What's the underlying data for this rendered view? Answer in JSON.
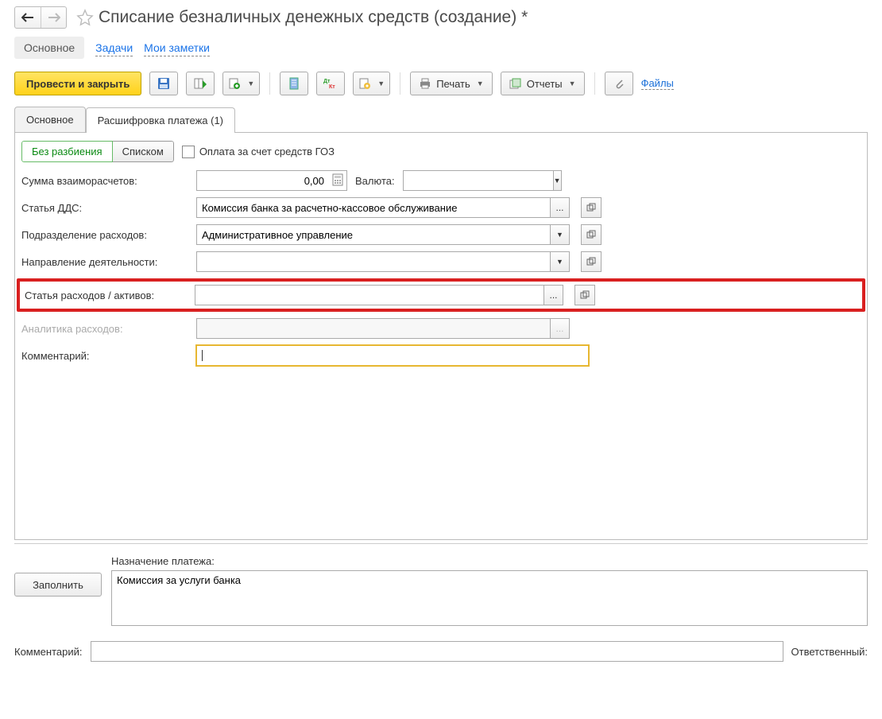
{
  "header": {
    "title": "Списание безналичных денежных средств (создание) *"
  },
  "sectionTabs": {
    "main": "Основное",
    "tasks": "Задачи",
    "notes": "Мои заметки"
  },
  "toolbar": {
    "postClose": "Провести и закрыть",
    "print": "Печать",
    "reports": "Отчеты",
    "files": "Файлы"
  },
  "tabs": {
    "main": "Основное",
    "decode": "Расшифровка платежа (1)"
  },
  "sub": {
    "noSplit": "Без разбиения",
    "asList": "Списком",
    "gozPay": "Оплата за счет средств ГОЗ"
  },
  "fields": {
    "sumLabel": "Сумма взаиморасчетов:",
    "sumValue": "0,00",
    "currencyLabel": "Валюта:",
    "currencyValue": "",
    "ddsLabel": "Статья ДДС:",
    "ddsValue": "Комиссия банка за расчетно-кассовое обслуживание",
    "deptLabel": "Подразделение расходов:",
    "deptValue": "Административное управление",
    "dirLabel": "Направление деятельности:",
    "dirValue": "",
    "expLabel": "Статья расходов / активов:",
    "expValue": "",
    "analyticsLabel": "Аналитика расходов:",
    "analyticsValue": "",
    "commentLabel": "Комментарий:",
    "commentValue": ""
  },
  "bottom": {
    "fillBtn": "Заполнить",
    "purposeLabel": "Назначение платежа:",
    "purposeValue": "Комиссия за услуги банка"
  },
  "footer": {
    "commentLabel": "Комментарий:",
    "commentValue": "",
    "responsibleLabel": "Ответственный:"
  }
}
